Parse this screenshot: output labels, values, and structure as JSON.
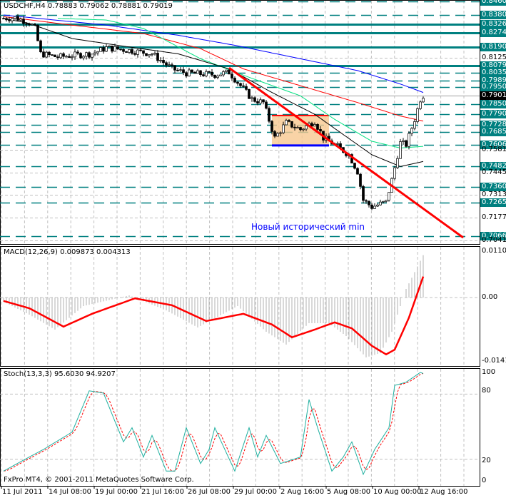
{
  "header": {
    "symbol_line": "USDCHF,H4  0.78883 0.79062 0.78881 0.79019"
  },
  "annotation": "Новый исторический min",
  "copyright": "FxPro MT4, © 2001-2011 MetaQuotes Software Corp.",
  "colors": {
    "level": "#008080",
    "trend": "#ff0000",
    "ma_blue": "#0000ff",
    "ma_red": "#ff0000",
    "ma_green": "#00e080",
    "ma_black": "#000000",
    "box": "#f8c890",
    "support": "#0000ff"
  },
  "chart_data": [
    {
      "type": "candlestick",
      "title": "USDCHF,H4",
      "ylim": [
        0.7041,
        0.846
      ],
      "current_price": "0.79019",
      "close_keypoints": [
        [
          0,
          0.836
        ],
        [
          4,
          0.8365
        ],
        [
          9,
          0.8335
        ],
        [
          11,
          0.83
        ],
        [
          13,
          0.815
        ],
        [
          19,
          0.813
        ],
        [
          24,
          0.814
        ],
        [
          31,
          0.815
        ],
        [
          36,
          0.8185
        ],
        [
          44,
          0.817
        ],
        [
          52,
          0.815
        ],
        [
          59,
          0.806
        ],
        [
          64,
          0.8035
        ],
        [
          74,
          0.8025
        ],
        [
          79,
          0.804
        ],
        [
          82,
          0.798
        ],
        [
          87,
          0.788
        ],
        [
          91,
          0.786
        ],
        [
          95,
          0.765
        ],
        [
          99,
          0.774
        ],
        [
          104,
          0.77
        ],
        [
          109,
          0.775
        ],
        [
          112,
          0.765
        ],
        [
          116,
          0.761
        ],
        [
          121,
          0.755
        ],
        [
          124,
          0.745
        ],
        [
          126,
          0.728
        ],
        [
          129,
          0.724
        ],
        [
          134,
          0.727
        ],
        [
          136,
          0.74
        ],
        [
          139,
          0.762
        ],
        [
          141,
          0.761
        ],
        [
          144,
          0.776
        ],
        [
          146,
          0.788
        ],
        [
          147,
          0.7902
        ]
      ],
      "moving_averages": [
        {
          "name": "ma_blue",
          "points": [
            [
              0,
              0.838
            ],
            [
              36,
              0.832
            ],
            [
              61,
              0.826
            ],
            [
              81,
              0.82
            ],
            [
              104,
              0.812
            ],
            [
              124,
              0.805
            ],
            [
              139,
              0.797
            ],
            [
              147,
              0.792
            ]
          ]
        },
        {
          "name": "ma_red",
          "points": [
            [
              0,
              0.837
            ],
            [
              24,
              0.832
            ],
            [
              49,
              0.827
            ],
            [
              69,
              0.818
            ],
            [
              84,
              0.806
            ],
            [
              104,
              0.796
            ],
            [
              124,
              0.786
            ],
            [
              139,
              0.778
            ],
            [
              147,
              0.775
            ]
          ]
        },
        {
          "name": "ma_green",
          "points": [
            [
              19,
              0.836
            ],
            [
              36,
              0.835
            ],
            [
              49,
              0.83
            ],
            [
              69,
              0.812
            ],
            [
              86,
              0.801
            ],
            [
              104,
              0.79
            ],
            [
              116,
              0.776
            ],
            [
              129,
              0.763
            ],
            [
              139,
              0.759
            ],
            [
              147,
              0.76
            ]
          ]
        },
        {
          "name": "ma_black",
          "points": [
            [
              0,
              0.836
            ],
            [
              9,
              0.833
            ],
            [
              24,
              0.824
            ],
            [
              44,
              0.819
            ],
            [
              61,
              0.815
            ],
            [
              79,
              0.806
            ],
            [
              94,
              0.792
            ],
            [
              109,
              0.779
            ],
            [
              119,
              0.767
            ],
            [
              129,
              0.755
            ],
            [
              139,
              0.748
            ],
            [
              147,
              0.751
            ]
          ]
        }
      ],
      "trendline": [
        [
          79,
          0.8066
        ],
        [
          161,
          0.7058
        ]
      ],
      "consolidation_box": {
        "from_bar": 94,
        "to_bar": 114,
        "high": 0.7783,
        "low": 0.7605
      },
      "level_labels": [
        {
          "v": 0.846,
          "t": "0.84600",
          "style": "level",
          "line": "dash"
        },
        {
          "v": 0.838,
          "t": "0.83800",
          "style": "level",
          "line": "dash"
        },
        {
          "v": 0.83262,
          "t": "0.83262",
          "style": "level",
          "line": "solid"
        },
        {
          "v": 0.82748,
          "t": "0.82748",
          "style": "level",
          "line": "solid"
        },
        {
          "v": 0.819,
          "t": "0.81900",
          "style": "level",
          "line": "solid"
        },
        {
          "v": 0.8125,
          "t": "0.81250",
          "style": "plain",
          "line": "none"
        },
        {
          "v": 0.80797,
          "t": "0.80797",
          "style": "level",
          "line": "solid"
        },
        {
          "v": 0.8035,
          "t": "0.80350",
          "style": "level",
          "line": "dash"
        },
        {
          "v": 0.79893,
          "t": "0.79893",
          "style": "level",
          "line": "dash"
        },
        {
          "v": 0.795,
          "t": "0.79500",
          "style": "level",
          "line": "dash"
        },
        {
          "v": 0.79019,
          "t": "0.79019",
          "style": "cur",
          "line": "none"
        },
        {
          "v": 0.785,
          "t": "0.78500",
          "style": "level",
          "line": "dash"
        },
        {
          "v": 0.779,
          "t": "0.77900",
          "style": "level",
          "line": "dash"
        },
        {
          "v": 0.77287,
          "t": "0.77287",
          "style": "level",
          "line": "dash"
        },
        {
          "v": 0.7685,
          "t": "0.76850",
          "style": "level",
          "line": "dash"
        },
        {
          "v": 0.76067,
          "t": "0.76067",
          "style": "level",
          "line": "dash"
        },
        {
          "v": 0.7581,
          "t": "0.75810",
          "style": "plain",
          "line": "none"
        },
        {
          "v": 0.7482,
          "t": "0.74820",
          "style": "level",
          "line": "dash"
        },
        {
          "v": 0.7445,
          "t": "0.74450",
          "style": "plain",
          "line": "none"
        },
        {
          "v": 0.736,
          "t": "0.73600",
          "style": "level",
          "line": "dash"
        },
        {
          "v": 0.7313,
          "t": "0.73130",
          "style": "plain",
          "line": "none"
        },
        {
          "v": 0.7265,
          "t": "0.72650",
          "style": "level",
          "line": "dash"
        },
        {
          "v": 0.7177,
          "t": "0.71770",
          "style": "plain",
          "line": "none"
        },
        {
          "v": 0.70667,
          "t": "0.70667",
          "style": "level",
          "line": "dash"
        },
        {
          "v": 0.7041,
          "t": "0.70410",
          "style": "plain",
          "line": "none"
        }
      ]
    },
    {
      "type": "bar+line",
      "title": "MACD(12,26,9) 0.009873 0.004313",
      "ylim": [
        -0.01412,
        0.01101
      ],
      "tick_labels": [
        "0.01101",
        "0.00",
        "-0.01412"
      ],
      "signal_keypoints": [
        [
          0,
          -0.0008
        ],
        [
          9,
          -0.0025
        ],
        [
          21,
          -0.0068
        ],
        [
          31,
          -0.0038
        ],
        [
          46,
          -0.0002
        ],
        [
          59,
          -0.0018
        ],
        [
          71,
          -0.0055
        ],
        [
          84,
          -0.0038
        ],
        [
          94,
          -0.0063
        ],
        [
          101,
          -0.0093
        ],
        [
          109,
          -0.0075
        ],
        [
          116,
          -0.0058
        ],
        [
          122,
          -0.0072
        ],
        [
          129,
          -0.0113
        ],
        [
          134,
          -0.0133
        ],
        [
          137,
          -0.0122
        ],
        [
          142,
          -0.0047
        ],
        [
          147,
          0.0049
        ]
      ],
      "main_keypoints": [
        [
          0,
          -0.001
        ],
        [
          9,
          -0.004
        ],
        [
          18,
          -0.0075
        ],
        [
          28,
          -0.002
        ],
        [
          44,
          0.0005
        ],
        [
          57,
          -0.003
        ],
        [
          68,
          -0.007
        ],
        [
          82,
          -0.002
        ],
        [
          92,
          -0.008
        ],
        [
          99,
          -0.011
        ],
        [
          107,
          -0.006
        ],
        [
          114,
          -0.006
        ],
        [
          120,
          -0.009
        ],
        [
          127,
          -0.014
        ],
        [
          132,
          -0.013
        ],
        [
          136,
          -0.008
        ],
        [
          141,
          0.002
        ],
        [
          147,
          0.0099
        ]
      ]
    },
    {
      "type": "line",
      "title": "Stoch(13,3,3) 95.6030 94.9207",
      "ylim": [
        0,
        100
      ],
      "tick_labels": [
        "100",
        "80",
        "20",
        "0"
      ],
      "main_keypoints": [
        [
          0,
          9
        ],
        [
          9,
          22
        ],
        [
          14,
          29
        ],
        [
          24,
          45
        ],
        [
          30,
          83
        ],
        [
          35,
          81
        ],
        [
          39,
          55
        ],
        [
          42,
          36
        ],
        [
          45,
          49
        ],
        [
          49,
          22
        ],
        [
          52,
          42
        ],
        [
          57,
          9
        ],
        [
          60,
          9
        ],
        [
          64,
          49
        ],
        [
          69,
          16
        ],
        [
          72,
          29
        ],
        [
          74,
          49
        ],
        [
          81,
          9
        ],
        [
          86,
          49
        ],
        [
          89,
          22
        ],
        [
          92,
          42
        ],
        [
          97,
          16
        ],
        [
          104,
          22
        ],
        [
          107,
          75
        ],
        [
          110,
          49
        ],
        [
          115,
          9
        ],
        [
          119,
          22
        ],
        [
          122,
          36
        ],
        [
          126,
          6
        ],
        [
          130,
          29
        ],
        [
          135,
          49
        ],
        [
          137,
          88
        ],
        [
          141,
          91
        ],
        [
          146,
          100
        ],
        [
          147,
          99
        ]
      ]
    }
  ],
  "time_axis": [
    "11 Jul 2011",
    "14 Jul 08:00",
    "19 Jul 00:00",
    "21 Jul 16:00",
    "26 Jul 08:00",
    "29 Jul 00:00",
    "2 Aug 16:00",
    "5 Aug 08:00",
    "10 Aug 00:00",
    "12 Aug 16:00"
  ]
}
